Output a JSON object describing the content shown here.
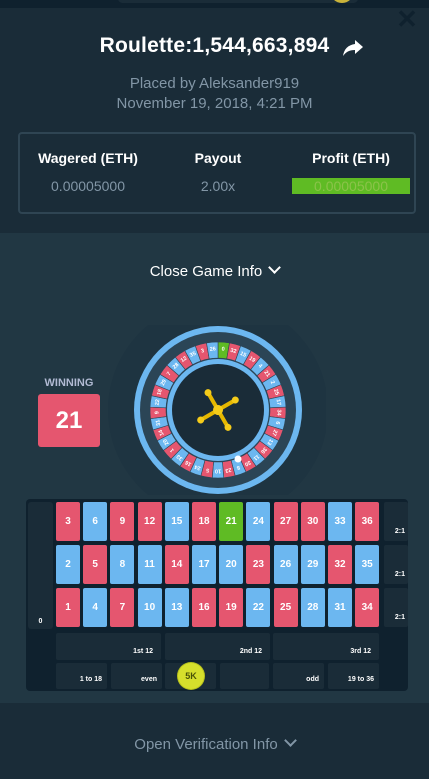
{
  "header": {
    "title": "Roulette:1,544,663,894",
    "placed_by": "Placed by Aleksander919",
    "date": "November 19, 2018, 4:21 PM"
  },
  "stats": {
    "wagered_label": "Wagered (ETH)",
    "wagered_value": "0.00005000",
    "payout_label": "Payout",
    "payout_value": "2.00x",
    "profit_label": "Profit (ETH)",
    "profit_value": "0.00005000"
  },
  "toggles": {
    "close_game_info": "Close Game Info",
    "open_verification": "Open Verification Info"
  },
  "winning": {
    "label": "WINNING",
    "number": "21"
  },
  "wheel": {
    "numbers": [
      "0",
      "32",
      "15",
      "19",
      "4",
      "21",
      "2",
      "25",
      "17",
      "34",
      "6",
      "27",
      "13",
      "36",
      "11",
      "30",
      "8",
      "23",
      "10",
      "5",
      "24",
      "16",
      "33",
      "1",
      "20",
      "14",
      "31",
      "9",
      "22",
      "18",
      "29",
      "7",
      "28",
      "12",
      "35",
      "3",
      "26"
    ],
    "winning_number": "21"
  },
  "board": {
    "zero": "0",
    "rows": [
      [
        {
          "n": "3",
          "c": "red"
        },
        {
          "n": "6",
          "c": "blue"
        },
        {
          "n": "9",
          "c": "red"
        },
        {
          "n": "12",
          "c": "red"
        },
        {
          "n": "15",
          "c": "blue"
        },
        {
          "n": "18",
          "c": "red"
        },
        {
          "n": "21",
          "c": "green"
        },
        {
          "n": "24",
          "c": "blue"
        },
        {
          "n": "27",
          "c": "red"
        },
        {
          "n": "30",
          "c": "red"
        },
        {
          "n": "33",
          "c": "blue"
        },
        {
          "n": "36",
          "c": "red"
        }
      ],
      [
        {
          "n": "2",
          "c": "blue"
        },
        {
          "n": "5",
          "c": "red"
        },
        {
          "n": "8",
          "c": "blue"
        },
        {
          "n": "11",
          "c": "blue"
        },
        {
          "n": "14",
          "c": "red"
        },
        {
          "n": "17",
          "c": "blue"
        },
        {
          "n": "20",
          "c": "blue"
        },
        {
          "n": "23",
          "c": "red"
        },
        {
          "n": "26",
          "c": "blue"
        },
        {
          "n": "29",
          "c": "blue"
        },
        {
          "n": "32",
          "c": "red"
        },
        {
          "n": "35",
          "c": "blue"
        }
      ],
      [
        {
          "n": "1",
          "c": "red"
        },
        {
          "n": "4",
          "c": "blue"
        },
        {
          "n": "7",
          "c": "red"
        },
        {
          "n": "10",
          "c": "blue"
        },
        {
          "n": "13",
          "c": "blue"
        },
        {
          "n": "16",
          "c": "red"
        },
        {
          "n": "19",
          "c": "red"
        },
        {
          "n": "22",
          "c": "blue"
        },
        {
          "n": "25",
          "c": "red"
        },
        {
          "n": "28",
          "c": "blue"
        },
        {
          "n": "31",
          "c": "blue"
        },
        {
          "n": "34",
          "c": "red"
        }
      ]
    ],
    "column_bets": [
      "2:1",
      "2:1",
      "2:1"
    ],
    "dozens": [
      "1st 12",
      "2nd 12",
      "3rd 12"
    ],
    "outside": [
      "1 to 18",
      "even",
      "",
      "",
      "odd",
      "19 to 36"
    ],
    "chip_label": "5K"
  },
  "colors": {
    "red": "#e5566f",
    "blue": "#6cb7f0",
    "green": "#5fbb24",
    "profit": "#8bc34a",
    "background": "#1a2c38"
  }
}
